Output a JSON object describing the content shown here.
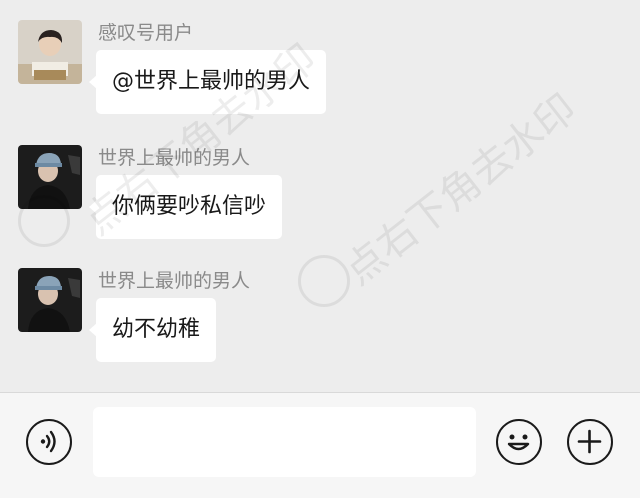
{
  "messages": [
    {
      "sender": "感叹号用户",
      "text": "@世界上最帅的男人"
    },
    {
      "sender": "世界上最帅的男人",
      "text": "你俩要吵私信吵"
    },
    {
      "sender": "世界上最帅的男人",
      "text": "幼不幼稚"
    }
  ],
  "watermark": {
    "text": "点右下角去水印"
  },
  "input": {
    "value": "",
    "placeholder": ""
  },
  "icons": {
    "voice": "voice-icon",
    "emoji": "emoji-icon",
    "plus": "plus-icon"
  }
}
